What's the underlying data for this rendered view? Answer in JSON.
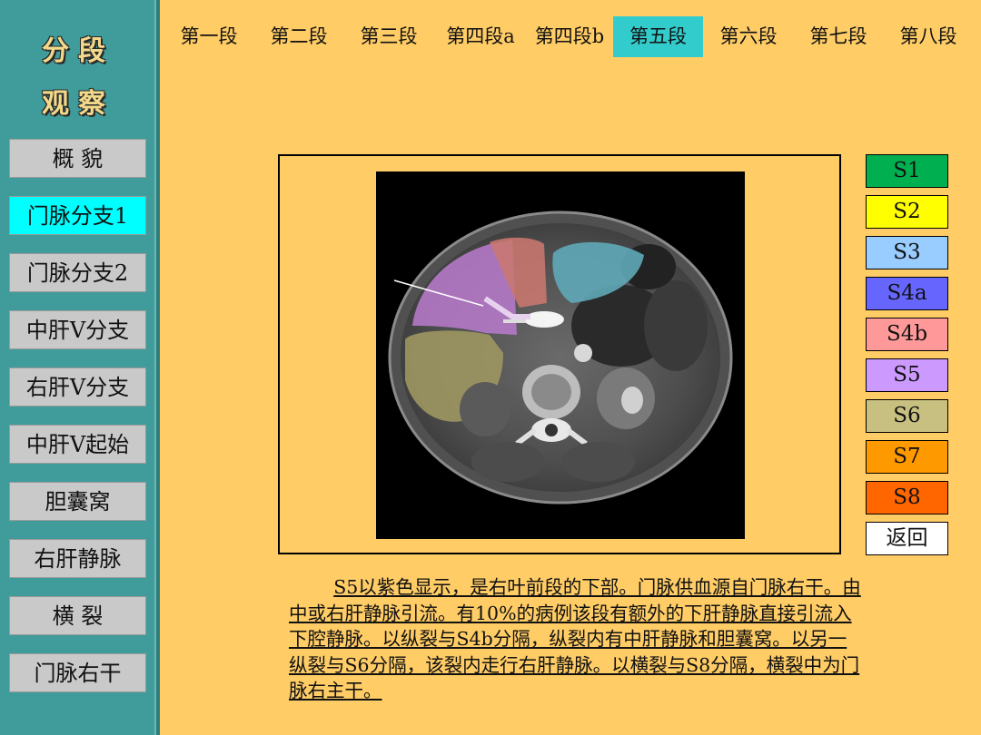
{
  "sidebar": {
    "title_line1": "分段",
    "title_line2": "观察",
    "items": [
      {
        "label": "概  貌"
      },
      {
        "label": "门脉分支1"
      },
      {
        "label": "门脉分支2"
      },
      {
        "label": "中肝V分支"
      },
      {
        "label": "右肝V分支"
      },
      {
        "label": "中肝V起始"
      },
      {
        "label": "胆囊窝"
      },
      {
        "label": "右肝静脉"
      },
      {
        "label": "横 裂"
      },
      {
        "label": "门脉右干"
      }
    ],
    "active_item": "门脉分支1"
  },
  "topnav": {
    "tabs": [
      {
        "label": "第一段"
      },
      {
        "label": "第二段"
      },
      {
        "label": "第三段"
      },
      {
        "label": "第四段a"
      },
      {
        "label": "第四段b"
      },
      {
        "label": "第五段"
      },
      {
        "label": "第六段"
      },
      {
        "label": "第七段"
      },
      {
        "label": "第八段"
      }
    ],
    "active_tab": "第五段"
  },
  "legend": {
    "items": [
      {
        "label": "S1",
        "color": "#00B050"
      },
      {
        "label": "S2",
        "color": "#FFFF00"
      },
      {
        "label": "S3",
        "color": "#99CCFF"
      },
      {
        "label": "S4a",
        "color": "#6666FF"
      },
      {
        "label": "S4b",
        "color": "#FF9999"
      },
      {
        "label": "S5",
        "color": "#CC99FF"
      },
      {
        "label": "S6",
        "color": "#C8C080"
      },
      {
        "label": "S7",
        "color": "#FF9900"
      },
      {
        "label": "S8",
        "color": "#FF6600"
      }
    ],
    "back_label": "返回",
    "back_color": "#FFFFFF"
  },
  "description": "S5以紫色显示，是右叶前段的下部。门脉供血源自门脉右干。由中或右肝静脉引流。有10%的病例该段有额外的下肝静脉直接引流入下腔静脉。以纵裂与S4b分隔，纵裂内有中肝静脉和胆囊窝。以另一纵裂与S6分隔，该裂内走行右肝静脉。以横裂与S8分隔，横裂中为门脉右主干。",
  "colors": {
    "background": "#FFCC66",
    "sidebar": "#3F9C9A",
    "active_sidebar": "#00FFFF",
    "active_tab": "#33CCCC"
  }
}
